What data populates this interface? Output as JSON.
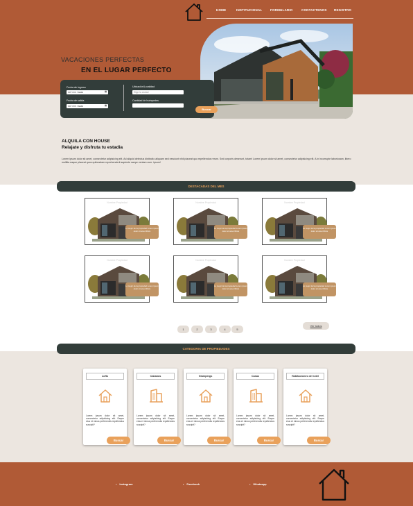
{
  "nav": {
    "items": [
      "HOME",
      "INSTITUCIONAL",
      "FORMULARIO",
      "CONTACTENOS",
      "REGISTRO"
    ]
  },
  "hero": {
    "title_line1": "VACACIONES PERFECTAS",
    "title_line2": "EN EL LUGAR PERFECTO"
  },
  "search": {
    "checkin_label": "Fecha de ingreso",
    "checkin_value": "dd / mm / aaaa",
    "checkout_label": "Fecha de salida",
    "checkout_value": "dd / mm / aaaa",
    "location_label": "Ubicación/Localidad",
    "location_placeholder": "Elige la ciudad",
    "guests_label": "Cantidad de huéspedes",
    "button": "Buscar"
  },
  "about": {
    "heading1": "ALQUILA CON HOUSE",
    "heading2": "Relajate y disfruta tu estadia",
    "body": "Lorem ipsum dolor sit amet, consectetur adipisicing elit. Ad aliquid delectus distinctio aliquam sed nesciunt nihil placeat quo repellendus rerum. Sed corporis deserunt, totam! Lorem ipsum dolor sit amet, consectetur adipisicing elit. A in incorrupte laboriosam, libero mollitia eaque placeat quos quibusdam reprehenderit sapiente saepe veniam cum. ipsum!"
  },
  "featured": {
    "title": "DESTACADAS DEL MES",
    "cards": [
      {
        "name": "Nombre Propiedad",
        "tag": "Lo mejor de la propiedad Lorem ipsum dolor sit amet lillmis"
      },
      {
        "name": "Nombre Propiedad",
        "tag": "Lo mejor de la propiedad Lorem ipsum dolor sit amet lillmis"
      },
      {
        "name": "Nombre Propiedad",
        "tag": "Lo mejor de la propiedad Lorem ipsum dolor sit amet lillmis"
      },
      {
        "name": "Nombre Propiedad",
        "tag": "Lo mejor de la propiedad Lorem ipsum dolor sit amet lillmis"
      },
      {
        "name": "Nombre Propiedad",
        "tag": "Lo mejor de la propiedad Lorem ipsum dolor sit amet lillmis"
      },
      {
        "name": "Nombre Propiedad",
        "tag": "Lo mejor de la propiedad Lorem ipsum dolor sit amet lillmis"
      }
    ],
    "pages": [
      "1",
      "2",
      "3",
      "4",
      "5"
    ],
    "see_all": "Ver todos"
  },
  "categories": {
    "title": "CATEGORIA DE PROPIEDADES",
    "items": [
      {
        "name": "Lofts",
        "icon": "house-icon",
        "desc": "Lorem ipsum dolor sit amet, consectetur adipisicing elit. Eaque eius et minus perferendis repellendus suscipit?",
        "button": "Buscar"
      },
      {
        "name": "Cabanas",
        "icon": "building-icon",
        "desc": "Lorem ipsum dolor sit amet, consectetur adipisicing elit. Eaque eius et minus perferendis repellendus suscipit?",
        "button": "Buscar"
      },
      {
        "name": "Glampings",
        "icon": "house-icon",
        "desc": "Lorem ipsum dolor sit amet, consectetur adipisicing elit. Eaque eius et minus perferendis repellendus suscipit?",
        "button": "Buscar"
      },
      {
        "name": "Casas",
        "icon": "building-icon",
        "desc": "Lorem ipsum dolor sit amet, consectetur adipisicing elit. Eaque eius et minus perferendis repellendus suscipit?",
        "button": "Buscar"
      },
      {
        "name": "Habitaciones de hotel",
        "icon": "house-icon",
        "desc": "Lorem ipsum dolor sit amet, consectetur adipisicing elit. Eaque eius et minus perferendis repellendus suscipit?",
        "button": "Buscar"
      }
    ]
  },
  "footer": {
    "links": [
      "Instagram",
      "Facebook",
      "Whatsapp"
    ]
  },
  "colors": {
    "brand_rust": "#b05a36",
    "dark_slate": "#323d3a",
    "accent_orange": "#e9a15b",
    "beige": "#ece6e0"
  }
}
